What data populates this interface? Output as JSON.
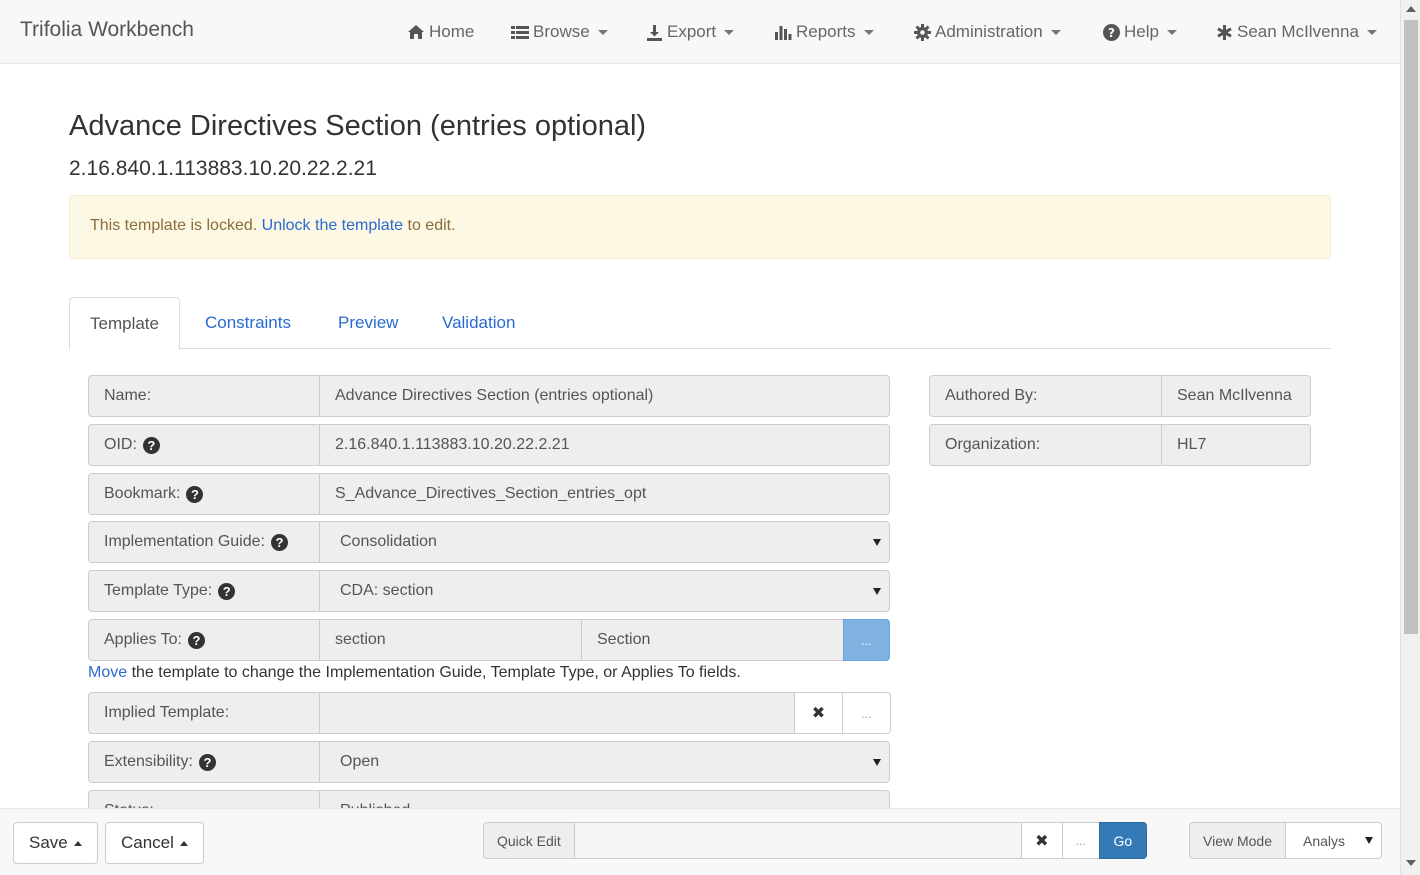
{
  "navbar": {
    "brand": "Trifolia Workbench",
    "items": [
      {
        "label": "Home",
        "icon": "home-icon"
      },
      {
        "label": "Browse",
        "icon": "list-icon"
      },
      {
        "label": "Export",
        "icon": "download-icon"
      },
      {
        "label": "Reports",
        "icon": "bar-chart-icon"
      },
      {
        "label": "Administration",
        "icon": "gear-icon"
      },
      {
        "label": "Help",
        "icon": "question-circle-icon"
      },
      {
        "label": "Sean McIlvenna",
        "icon": "asterisk-icon"
      }
    ]
  },
  "header": {
    "title": "Advance Directives Section (entries optional)",
    "oid": "2.16.840.1.113883.10.20.22.2.21"
  },
  "alert": {
    "before": "This template is locked.",
    "link": "Unlock the template",
    "after": "to edit."
  },
  "tabs": [
    "Template",
    "Constraints",
    "Preview",
    "Validation"
  ],
  "form": {
    "name": {
      "label": "Name:",
      "value": "Advance Directives Section (entries optional)"
    },
    "oid": {
      "label": "OID:",
      "value": "2.16.840.1.113883.10.20.22.2.21"
    },
    "bookmark": {
      "label": "Bookmark:",
      "value": "S_Advance_Directives_Section_entries_opt"
    },
    "implementation_guide": {
      "label": "Implementation Guide:",
      "value": "Consolidation"
    },
    "template_type": {
      "label": "Template Type:",
      "value": "CDA: section"
    },
    "applies_to": {
      "label": "Applies To:",
      "value1": "section",
      "value2": "Section",
      "button": "..."
    },
    "move_note": {
      "link": "Move",
      "text": "the template to change the Implementation Guide, Template Type, or Applies To fields."
    },
    "implied_template": {
      "label": "Implied Template:",
      "value": "",
      "clear": "✖",
      "browse": "..."
    },
    "extensibility": {
      "label": "Extensibility:",
      "value": "Open"
    },
    "status": {
      "label": "Status:",
      "value": "Published"
    }
  },
  "side": {
    "authored_by": {
      "label": "Authored By:",
      "value": "Sean McIlvenna"
    },
    "organization": {
      "label": "Organization:",
      "value": "HL7"
    }
  },
  "footer": {
    "save": "Save",
    "cancel": "Cancel",
    "quick_edit_label": "Quick Edit",
    "quick_edit_value": "",
    "clear": "✖",
    "dots": "...",
    "go": "Go",
    "view_mode_label": "View Mode",
    "view_mode_value": "Analyst"
  },
  "colors": {
    "link": "#2a6ad2",
    "alert_bg": "#fcf8e3",
    "alert_text": "#8a6d3b",
    "primary": "#337ab7"
  }
}
